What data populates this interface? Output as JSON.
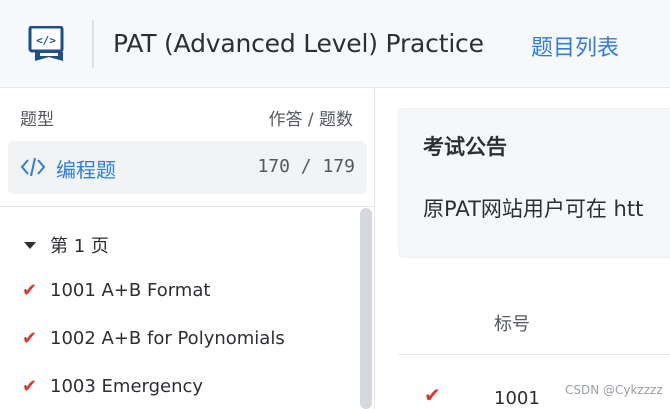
{
  "header": {
    "logo_icon": "code-book-icon",
    "title": "PAT (Advanced Level) Practice",
    "nav_link": "题目列表",
    "accent_color": "#2f7de1"
  },
  "sidebar": {
    "heading": "题型",
    "heading_right": "作答 / 题数",
    "category": {
      "icon": "code-icon",
      "label": "编程题",
      "count": "170 / 179"
    },
    "page_group": "第 1 页",
    "problems": [
      {
        "label": "1001 A+B Format",
        "status": "solved"
      },
      {
        "label": "1002 A+B for Polynomials",
        "status": "solved"
      },
      {
        "label": "1003 Emergency",
        "status": "solved"
      }
    ],
    "check_glyph": "✔"
  },
  "notice": {
    "title": "考试公告",
    "body": "原PAT网站用户可在 htt"
  },
  "table": {
    "column_id": "标号",
    "rows": [
      {
        "id": "1001",
        "status": "solved"
      }
    ]
  },
  "watermark": "CSDN @Cykzzzz",
  "status_color_solved": "#e0342e"
}
